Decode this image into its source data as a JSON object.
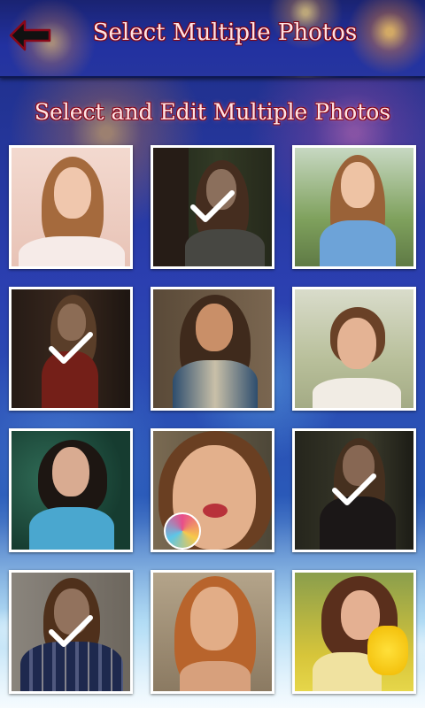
{
  "header": {
    "title": "Select Multiple Photos",
    "back_icon": "back-arrow-icon"
  },
  "subtitle": "Select and Edit Multiple Photos",
  "photos": [
    {
      "selected": false
    },
    {
      "selected": true
    },
    {
      "selected": false
    },
    {
      "selected": true
    },
    {
      "selected": false
    },
    {
      "selected": false
    },
    {
      "selected": false
    },
    {
      "selected": false
    },
    {
      "selected": true
    },
    {
      "selected": true
    },
    {
      "selected": false
    },
    {
      "selected": false
    }
  ],
  "colors": {
    "title_text": "#ffe2e2",
    "title_outline": "#8a0718",
    "bar_bg": "#2231a0",
    "check": "#ffffff"
  }
}
